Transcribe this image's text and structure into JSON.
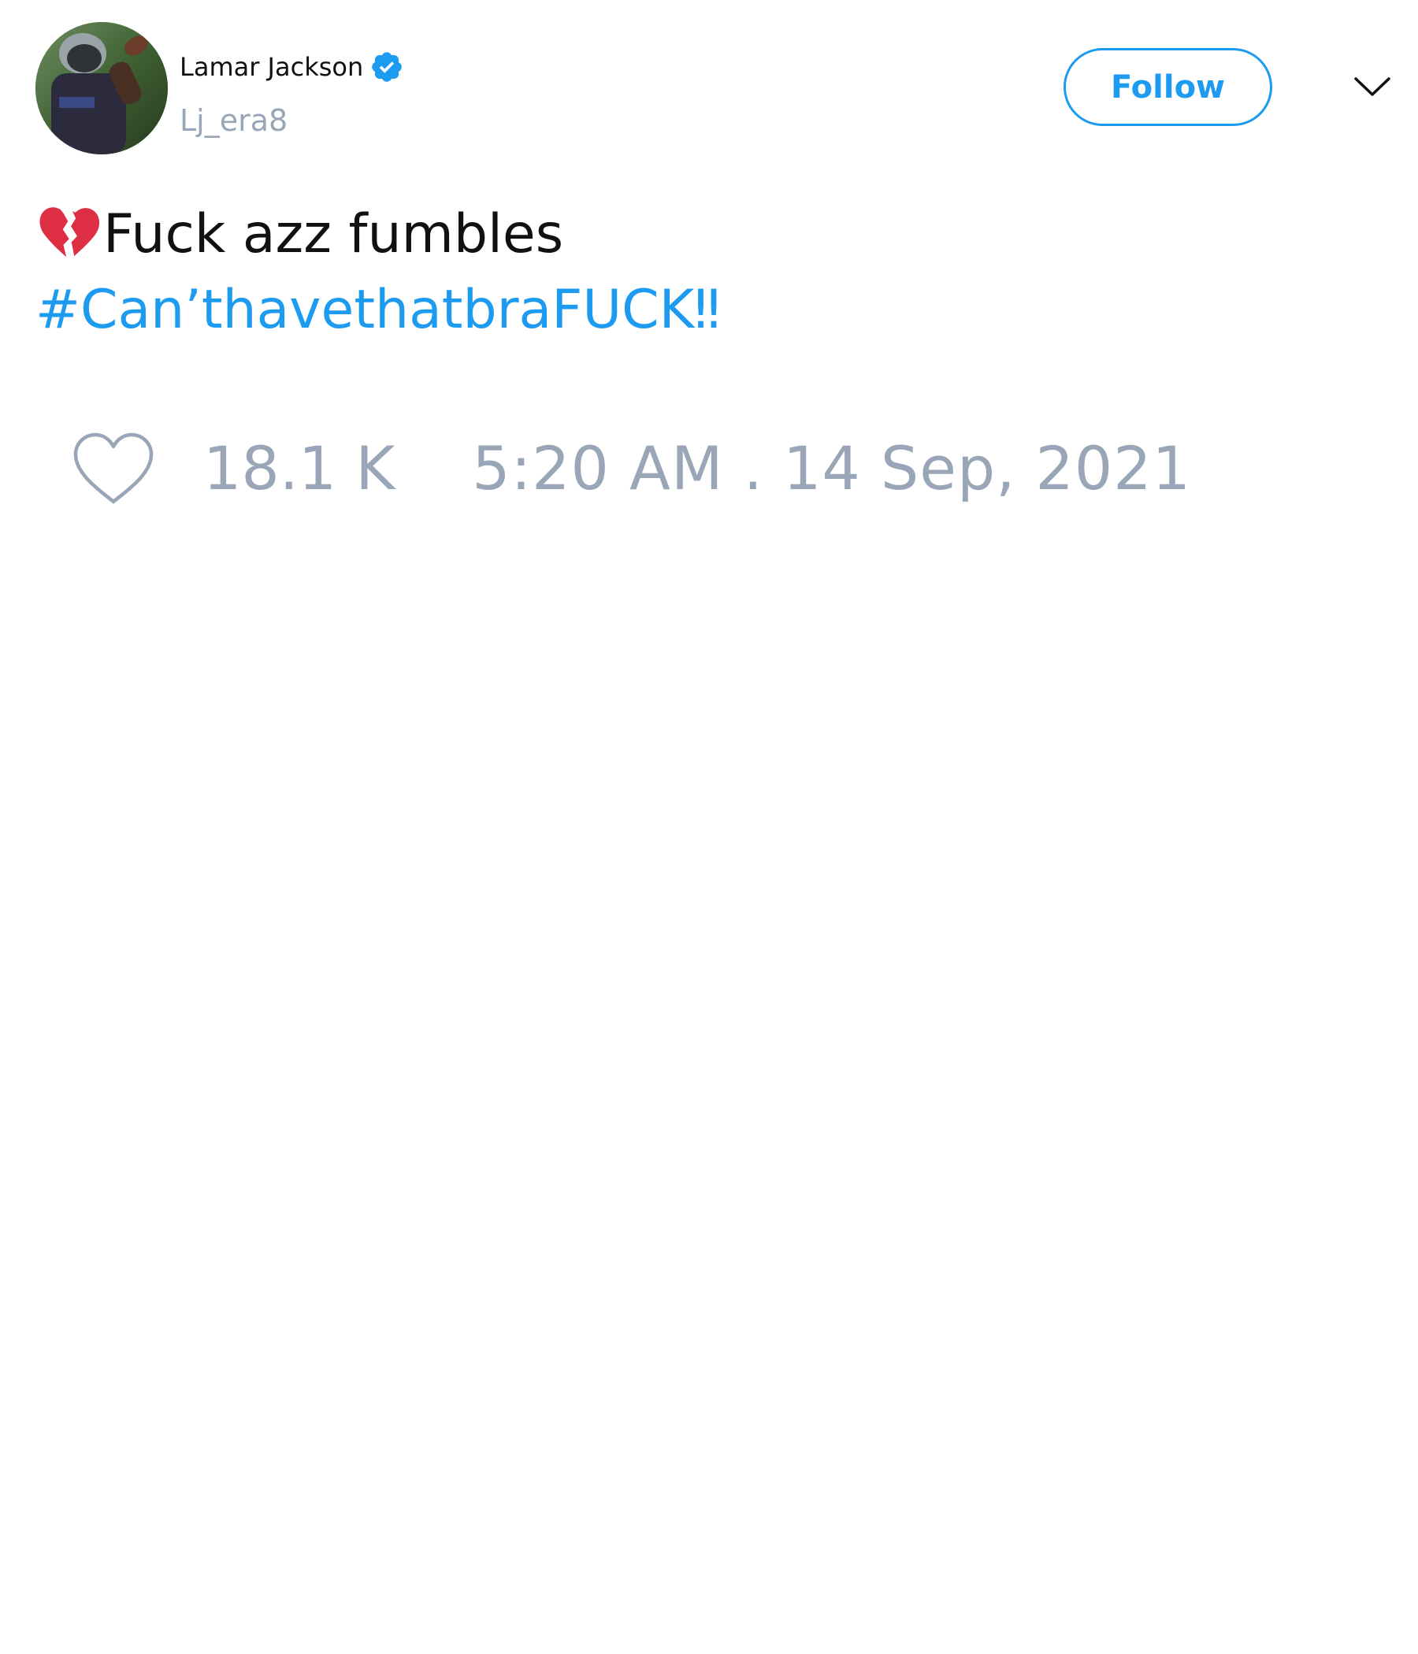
{
  "author": {
    "display_name": "Lamar Jackson",
    "handle": "Lj_era8",
    "verified": true,
    "avatar_icon": "avatar-football-player-photo"
  },
  "actions": {
    "follow_label": "Follow",
    "menu_icon": "chevron-down-icon"
  },
  "tweet": {
    "emoji_icon": "broken-heart-icon",
    "text": "Fuck azz fumbles",
    "hashtag": "#Can’thavethatbraFUCK‼"
  },
  "footer": {
    "like_icon": "heart-outline-icon",
    "like_count": "18.1 K",
    "timestamp": "5:20 AM . 14 Sep, 2021"
  },
  "colors": {
    "accent": "#1d9bf0",
    "muted_text": "#98a6b8",
    "primary_text": "#111111",
    "emoji_red": "#dd2e44"
  }
}
